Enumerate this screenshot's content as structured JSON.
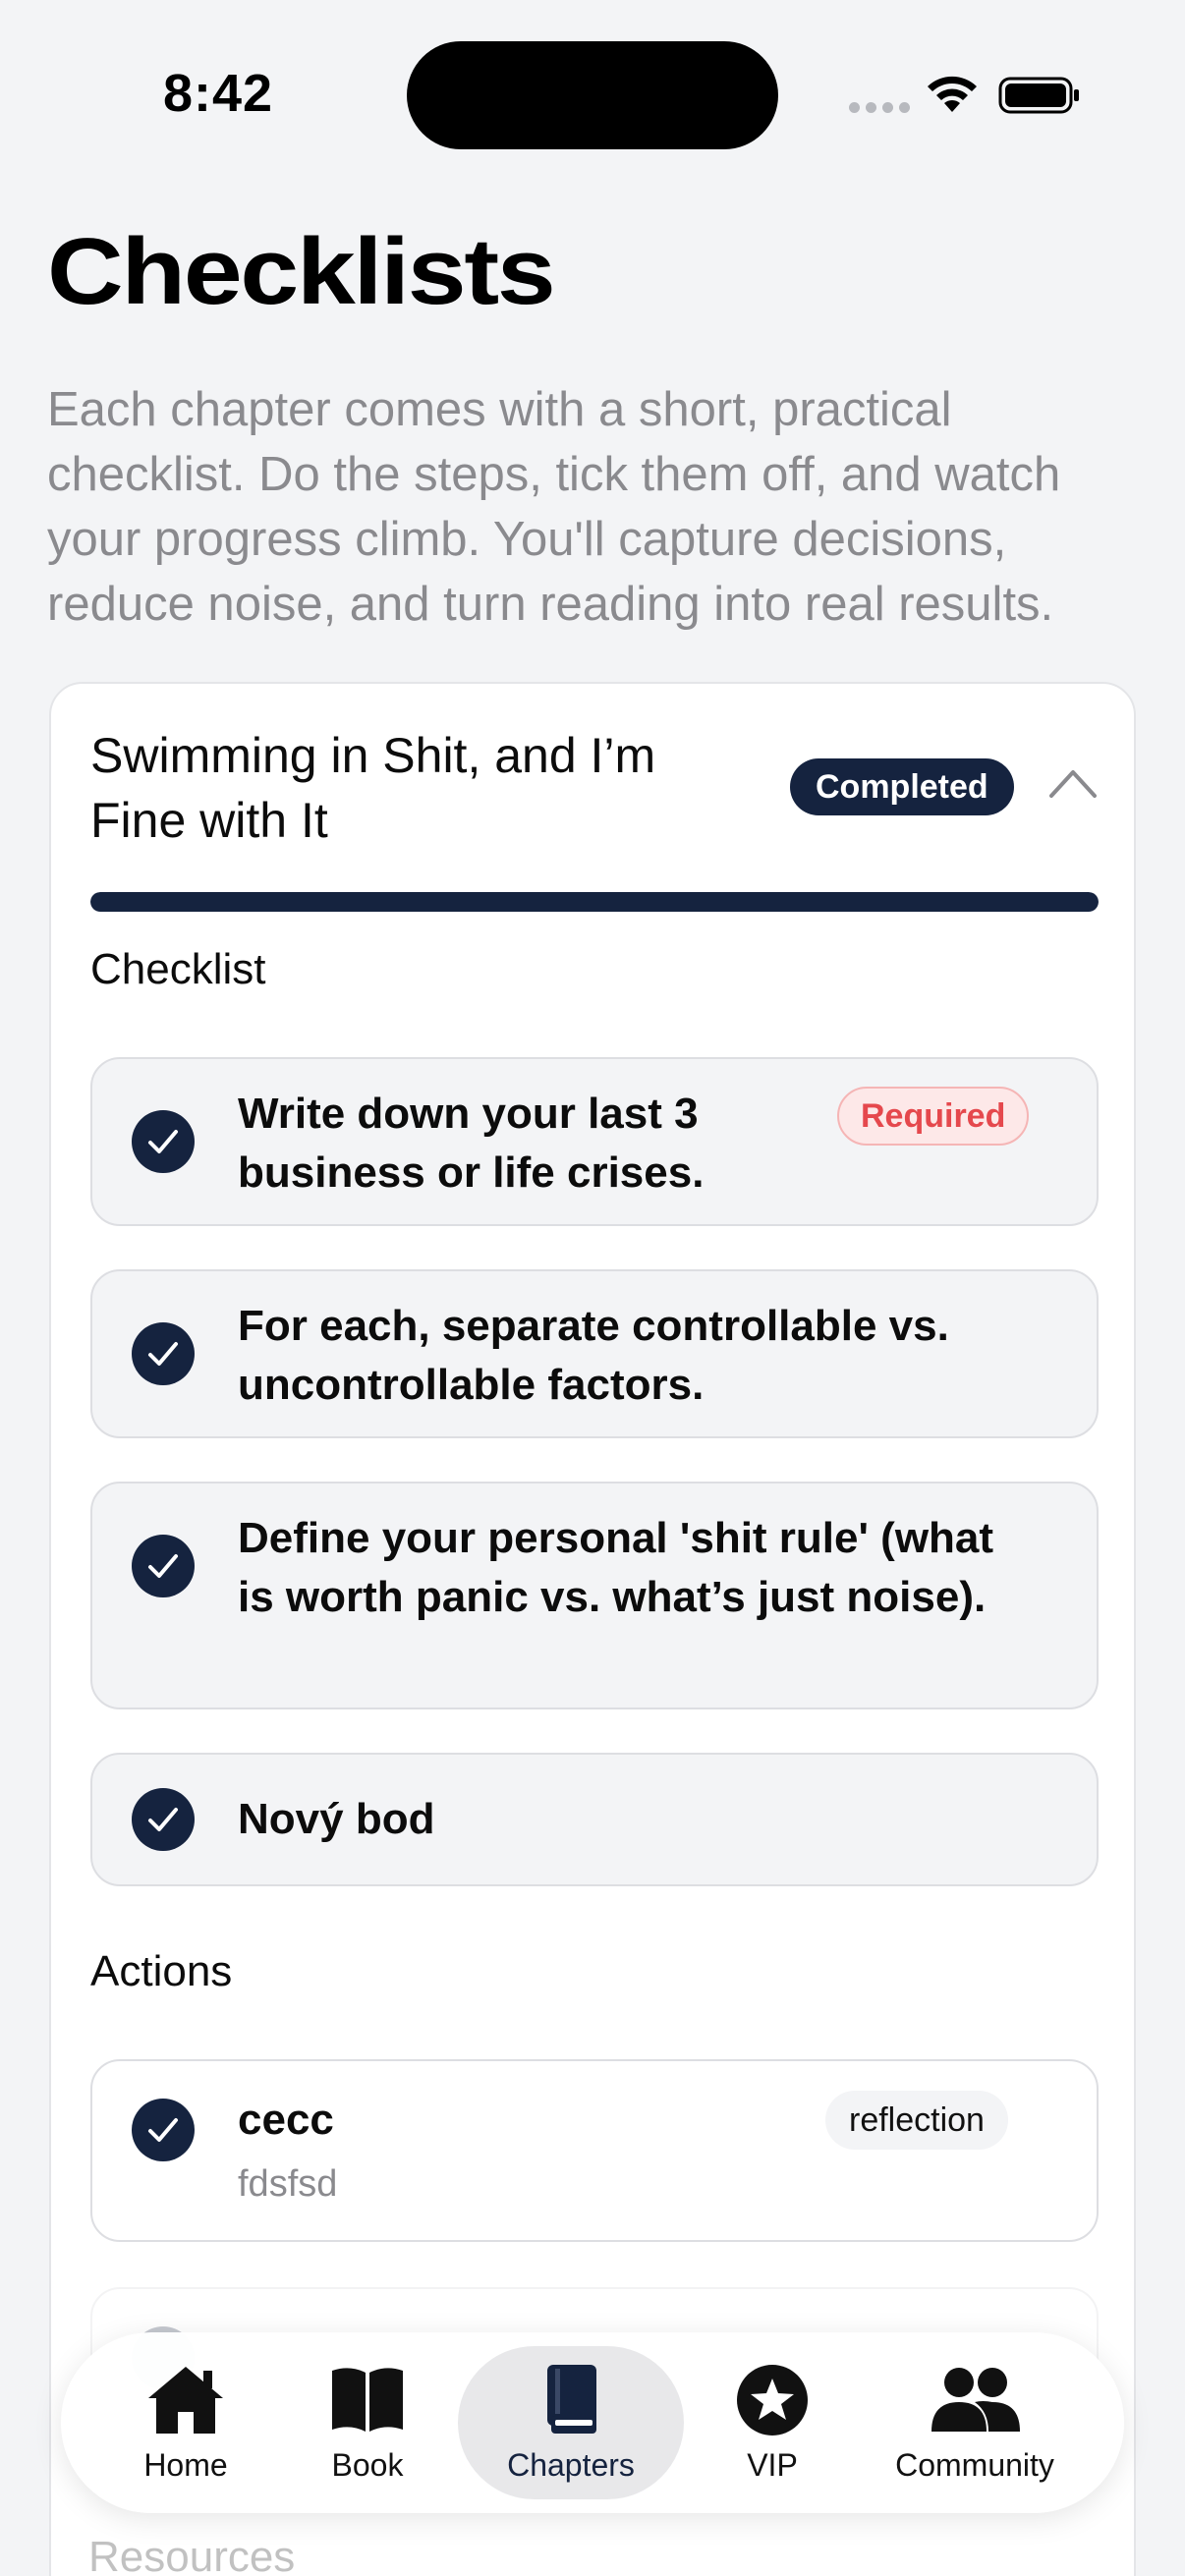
{
  "status": {
    "time": "8:42"
  },
  "header": {
    "title": "Checklists",
    "intro": "Each chapter comes with a short, practical checklist. Do the steps, tick them off, and watch your progress climb. You'll capture decisions, reduce noise, and turn reading into real results."
  },
  "chapter": {
    "title": "Swimming in Shit, and I’m Fine with It",
    "status_badge": "Completed",
    "progress": 1.0,
    "checklist_label": "Checklist",
    "checklist": [
      {
        "text": "Write down your last 3 business or life crises.",
        "badge": "Required",
        "checked": true
      },
      {
        "text": "For each, separate controllable vs. uncontrollable factors.",
        "checked": true
      },
      {
        "text": "Define your personal 'shit rule' (what is worth panic vs. what’s just noise).",
        "checked": true
      },
      {
        "text": "Nový bod",
        "checked": true
      }
    ],
    "actions_label": "Actions",
    "actions": [
      {
        "title": "cecc",
        "subtitle": "fdsfsd",
        "tag": "reflection",
        "checked": true
      }
    ],
    "resources_label": "Resources"
  },
  "tabbar": {
    "active": "Chapters",
    "items": [
      {
        "label": "Home",
        "icon": "house-icon"
      },
      {
        "label": "Book",
        "icon": "open-book-icon"
      },
      {
        "label": "Chapters",
        "icon": "book-icon"
      },
      {
        "label": "VIP",
        "icon": "star-badge-icon"
      },
      {
        "label": "Community",
        "icon": "people-icon"
      }
    ]
  },
  "colors": {
    "navy": "#15233f",
    "required_red": "#e5484d",
    "background": "#f3f4f6"
  }
}
